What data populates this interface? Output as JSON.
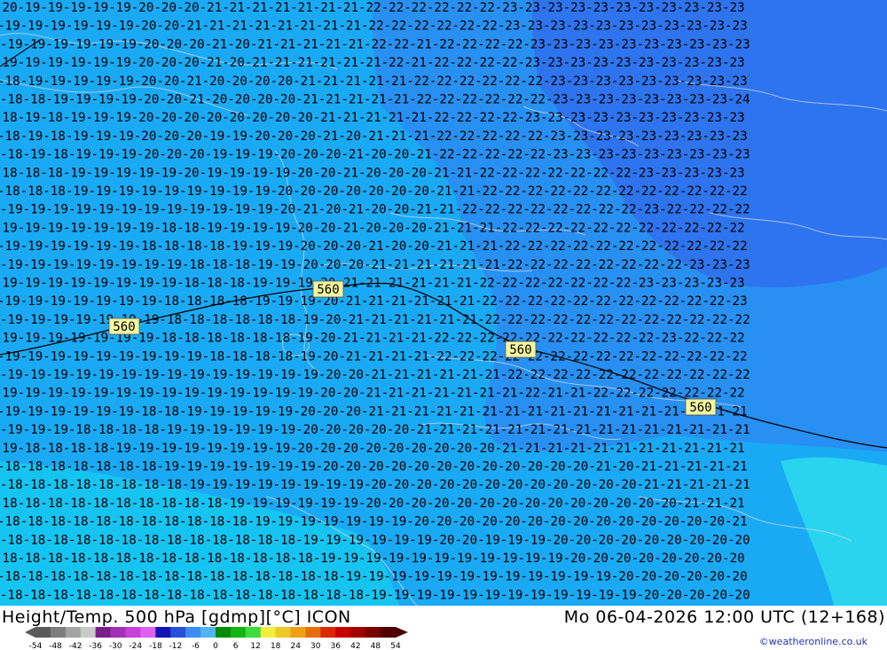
{
  "title": "Height/Temp. 500 hPa [gdmp][°C] ICON",
  "datetime": "Mo 06-04-2026 12:00 UTC (12+168)",
  "credit": "©weatheronline.co.uk",
  "contour_label": "560",
  "contour_label_count": 4,
  "scale": {
    "ticks": [
      "-54",
      "-48",
      "-42",
      "-36",
      "-30",
      "-24",
      "-18",
      "-12",
      "-6",
      "0",
      "6",
      "12",
      "18",
      "24",
      "30",
      "36",
      "42",
      "48",
      "54"
    ],
    "colors": [
      "#5a5a5a",
      "#7d7d7d",
      "#a3a3a3",
      "#c8c8c8",
      "#7a1e8c",
      "#a030b4",
      "#c840d8",
      "#e060f0",
      "#1414b4",
      "#2850dc",
      "#3c8cf0",
      "#50b4fa",
      "#008c00",
      "#14b414",
      "#3cdc3c",
      "#f0f03c",
      "#f0c828",
      "#f0a014",
      "#e66e0a",
      "#dc2800",
      "#c80000",
      "#a00000",
      "#780000",
      "#500000"
    ]
  },
  "fields": {
    "colors": {
      "cyan": "#16c4f2",
      "light_blue": "#1aaaf5",
      "mid_blue": "#2890f2",
      "deep_blue": "#2e74ee",
      "teal": "#2ad4ee"
    }
  },
  "temp_rows": [
    "-20-19-19-19-19-19-20-20-20-21-21-21-21-21-21-21-22-22-22-22-22-22-23-23-23-23-23-23-23-23-23-23-23",
    "-19-19-19-19-19-19-20-20-21-21-21-21-21-21-21-21-22-22-22-22-22-22-23-23-23-23-23-23-23-23-23-23-23",
    "-19-19-19-19-19-19-20-20-20-21-20-21-21-21-21-21-22-22-21-22-22-22-22-23-23-23-23-23-23-23-23-23-23",
    "-19-19-19-19-19-19-20-20-20-21-20-21-21-21-21-21-21-22-21-22-22-22-22-23-23-23-23-23-23-23-23-23-23",
    "-18-19-19-19-19-19-20-20-21-20-20-20-20-21-21-21-21-21-22-22-22-22-22-22-23-23-23-23-23-23-23-23-23",
    "-18-18-19-19-19-19-20-20-21-20-20-20-20-21-21-21-21-21-22-22-22-22-22-22-23-23-23-23-23-23-23-23-24",
    "-18-19-18-19-19-19-20-20-20-20-20-20-20-20-21-21-21-21-21-22-22-22-22-23-23-23-23-23-23-23-23-23-23",
    "-18-19-18-19-19-19-20-20-20-19-19-20-20-20-21-20-21-21-21-22-22-22-22-22-23-23-23-23-23-23-23-23-23",
    "-18-19-18-19-19-19-20-20-20-19-19-19-20-20-20-21-20-20-21-22-22-22-22-22-23-23-23-23-23-23-23-23-23",
    "-18-18-18-19-19-19-19-19-20-19-19-19-19-20-20-21-20-20-20-21-21-22-22-22-22-22-22-22-23-23-23-23-23",
    "-18-18-18-19-19-19-19-19-19-19-19-19-20-20-20-20-20-20-20-21-21-22-22-22-22-22-22-22-22-22-22-22-22",
    "-19-19-19-19-19-19-19-19-19-19-19-19-20-21-20-21-20-20-21-21-22-22-22-22-22-22-22-22-23-22-22-22-22",
    "-19-19-19-19-19-19-19-18-18-19-19-19-19-20-20-21-20-20-20-21-21-21-22-22-22-22-22-22-22-22-22-22-22",
    "-19-19-19-19-19-19-18-18-18-18-19-19-19-20-20-20-21-20-20-21-21-21-22-22-22-22-22-22-22-22-22-22-22",
    "-19-19-19-19-19-19-19-19-18-18-18-19-19-20-20-20-21-21-21-21-21-21-22-22-22-22-22-22-22-22-23-23-23",
    "-19-19-19-19-19-19-19-19-18-18-18-19-19-19-20-21-21-21-21-21-21-22-22-22-22-22-22-22-23-23-23-23-23",
    "-19-19-19-19-19-19-19-18-18-18-18-19-19-19-20-21-21-21-21-21-21-22-22-22-22-22-22-22-22-22-22-22-23",
    "-19-19-19-19-19-19-19-18-18-18-18-18-18-19-20-21-21-21-21-21-21-22-22-22-22-22-22-22-22-22-22-22-22",
    "-19-19-19-19-19-19-19-18-18-18-18-18-18-19-20-21-21-21-21-22-22-22-22-22-22-22-22-22-22-23-22-22-22",
    "-19-19-19-19-19-19-19-19-19-18-18-18-18-19-20-21-21-21-21-22-22-22-22-22-22-22-22-22-22-22-22-22-22",
    "-19-19-19-19-19-19-19-19-19-19-19-19-19-19-20-20-21-21-21-21-21-21-22-22-22-22-22-22-22-22-22-22-22",
    "-19-19-19-19-19-19-19-19-19-19-19-19-19-19-20-20-21-21-21-21-21-21-21-22-21-21-22-22-22-22-22-22-22",
    "-19-19-19-19-19-19-18-18-19-19-19-19-19-20-20-20-21-21-21-21-21-21-21-21-21-21-21-21-21-21-21-21-21",
    "-19-19-19-18-18-18-18-19-19-19-19-19-19-20-20-20-20-20-21-21-21-21-21-21-21-21-21-21-21-21-21-21-21",
    "-19-18-18-18-18-19-19-19-19-19-19-19-19-20-20-20-20-20-20-20-20-20-21-21-21-21-21-21-21-21-21-21-21",
    "-18-18-18-18-18-18-18-19-19-19-19-19-19-19-20-20-20-20-20-20-20-20-20-20-20-20-21-20-21-21-21-21-21",
    "-18-18-18-18-18-18-18-18-19-19-19-19-19-19-19-19-20-20-20-20-20-20-20-20-20-20-20-20-21-21-21-21-21",
    "-18-18-18-18-18-18-18-18-18-18-19-19-19-19-19-19-20-20-20-20-20-20-20-20-20-20-20-20-20-20-21-21-21",
    "-18-18-18-18-18-18-18-18-18-18-18-19-19-19-19-19-19-19-20-20-20-20-20-20-20-20-20-20-20-20-20-20-21",
    "-18-18-18-18-18-18-18-18-18-18-18-18-18-19-19-19-19-19-19-20-20-19-19-19-20-20-20-20-20-20-20-20-20",
    "-18-18-18-18-18-18-18-18-18-18-18-18-18-18-19-19-19-19-19-19-19-19-19-19-19-20-20-20-20-20-20-20-20",
    "-18-18-18-18-18-18-18-18-18-18-18-18-18-18-18-19-19-19-19-19-19-19-19-19-19-19-19-20-20-20-20-20-20",
    "-18-18-18-18-18-18-18-18-18-18-18-18-18-18-18-18-19-19-19-19-19-19-19-19-19-19-19-19-20-20-20-20-20"
  ]
}
